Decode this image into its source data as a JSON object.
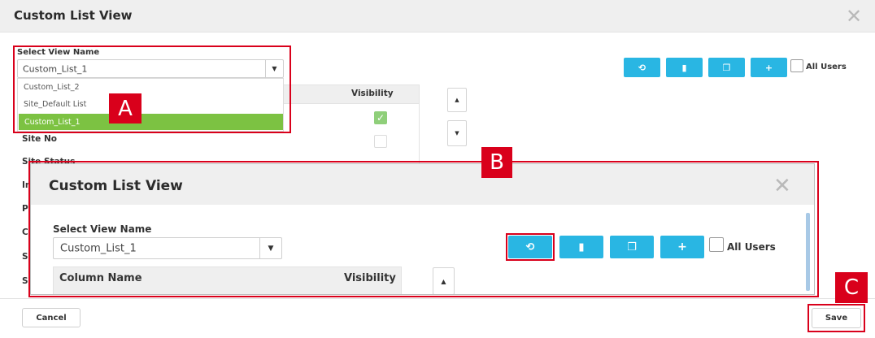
{
  "dialog": {
    "title": "Custom List View",
    "select_label": "Select View Name",
    "selected_view": "Custom_List_1",
    "dropdown_options": [
      "Custom_List_2",
      "Site_Default List",
      "Custom_List_1"
    ],
    "table": {
      "visibility_header": "Visibility",
      "rows": [
        "Site No",
        "Site Status",
        "In",
        "Pr",
        "Co",
        "Su",
        "Su"
      ]
    },
    "all_users_label": "All Users"
  },
  "inset": {
    "title": "Custom List View",
    "select_label": "Select View Name",
    "selected_view": "Custom_List_1",
    "column_name_header": "Column Name",
    "visibility_header": "Visibility",
    "all_users_label": "All Users"
  },
  "footer": {
    "cancel_label": "Cancel",
    "save_label": "Save"
  },
  "callouts": {
    "a": "A",
    "b": "B",
    "c": "C"
  },
  "icons": {
    "reset": "reset-icon",
    "delete": "trash-icon",
    "copy": "copy-icon",
    "add": "plus-icon",
    "close": "close-icon",
    "caret": "caret-down-icon",
    "check": "checkmark-icon"
  },
  "colors": {
    "accent": "#29b6e3",
    "selected_option": "#7cc242",
    "callout": "#d9001b",
    "check_green": "#8fcf7a"
  }
}
